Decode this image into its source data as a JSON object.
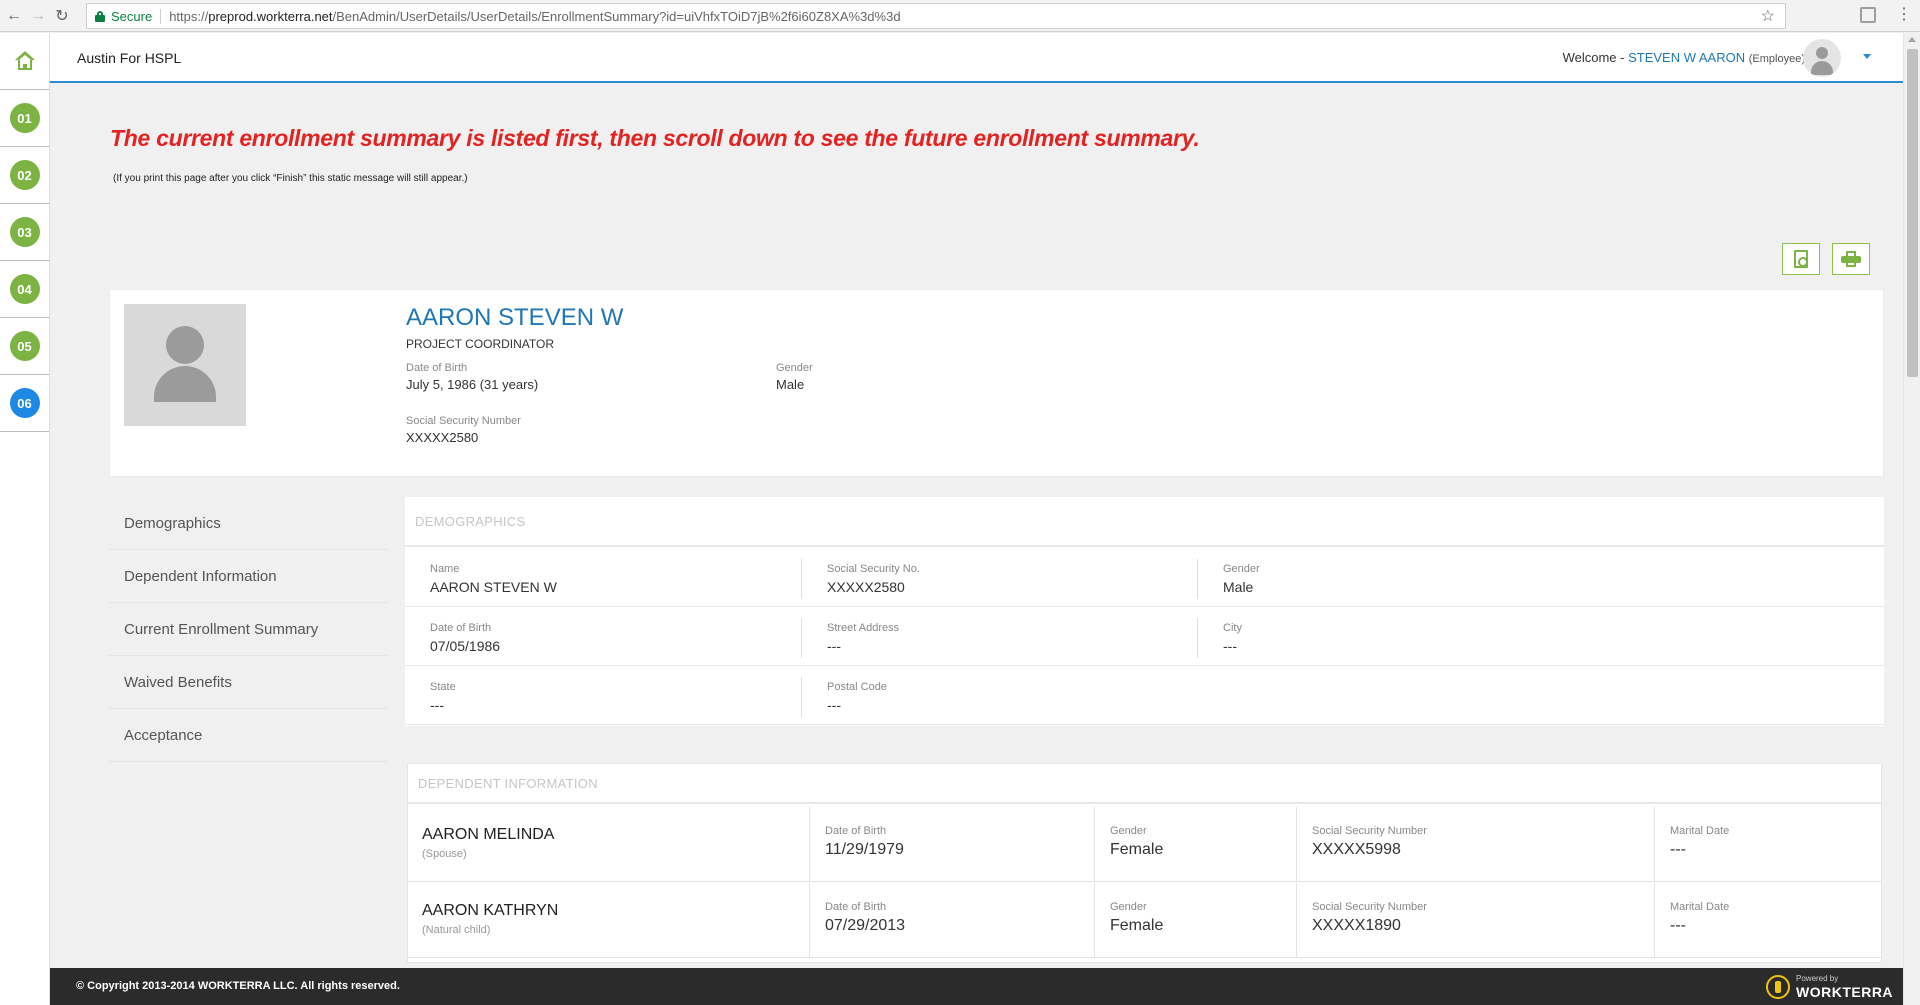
{
  "browser": {
    "secure_label": "Secure",
    "url_prefix": "https://",
    "url_host": "preprod.workterra.net",
    "url_path": "/BenAdmin/UserDetails/UserDetails/EnrollmentSummary?id=uiVhfxTOiD7jB%2f6i60Z8XA%3d%3d"
  },
  "steps": [
    "01",
    "02",
    "03",
    "04",
    "05",
    "06"
  ],
  "active_step": "06",
  "header": {
    "app_title": "Austin For HSPL",
    "welcome_label": "Welcome - ",
    "user_name": "STEVEN W AARON",
    "user_role": "(Employee)"
  },
  "notice": {
    "headline": "The current enrollment summary is listed first, then scroll down to see the future enrollment summary.",
    "subnote": "(If you print this page after you click “Finish” this static message will still appear.)"
  },
  "profile": {
    "name": "AARON STEVEN W",
    "title": "PROJECT COORDINATOR",
    "dob_label": "Date of Birth",
    "dob_value": "July 5, 1986 (31 years)",
    "gender_label": "Gender",
    "gender_value": "Male",
    "ssn_label": "Social Security Number",
    "ssn_value": "XXXXX2580"
  },
  "section_nav": [
    "Demographics",
    "Dependent Information",
    "Current Enrollment Summary",
    "Waived Benefits",
    "Acceptance"
  ],
  "demographics": {
    "header": "DEMOGRAPHICS",
    "rows": [
      [
        {
          "label": "Name",
          "value": "AARON STEVEN W"
        },
        {
          "label": "Social Security No.",
          "value": "XXXXX2580"
        },
        {
          "label": "Gender",
          "value": "Male"
        }
      ],
      [
        {
          "label": "Date of Birth",
          "value": "07/05/1986"
        },
        {
          "label": "Street Address",
          "value": "---"
        },
        {
          "label": "City",
          "value": "---"
        }
      ],
      [
        {
          "label": "State",
          "value": "---"
        },
        {
          "label": "Postal Code",
          "value": "---"
        }
      ]
    ]
  },
  "dependents": {
    "header": "DEPENDENT INFORMATION",
    "field_labels": {
      "dob": "Date of Birth",
      "gender": "Gender",
      "ssn": "Social Security Number",
      "marital": "Marital Date"
    },
    "rows": [
      {
        "name": "AARON MELINDA",
        "relation": "(Spouse)",
        "dob": "11/29/1979",
        "gender": "Female",
        "ssn": "XXXXX5998",
        "marital": "---"
      },
      {
        "name": "AARON KATHRYN",
        "relation": "(Natural child)",
        "dob": "07/29/2013",
        "gender": "Female",
        "ssn": "XXXXX1890",
        "marital": "---"
      }
    ]
  },
  "footer": {
    "copyright": "© Copyright 2013-2014 WORKTERRA LLC. All rights reserved.",
    "powered_by": "Powered by",
    "brand": "WORKTERRA"
  },
  "icons": {
    "home": "home-icon",
    "pdf": "pdf-icon",
    "print": "print-icon",
    "avatar": "user-avatar-icon"
  },
  "colors": {
    "accent_green": "#7cb342",
    "accent_blue": "#1f77b4",
    "notice_red": "#e32222",
    "active_step": "#1e88e5"
  }
}
